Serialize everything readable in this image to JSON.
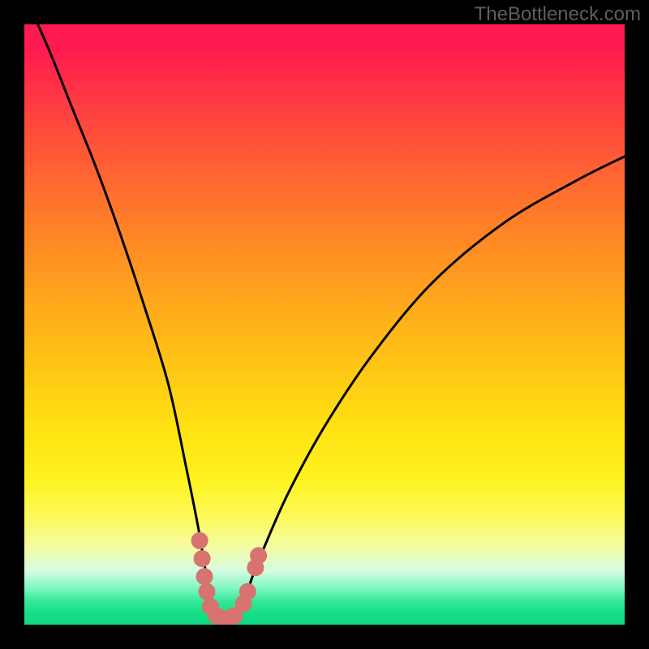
{
  "watermark": "TheBottleneck.com",
  "colors": {
    "frame": "#000000",
    "curve": "#000000",
    "marker_fill": "#d7746f",
    "marker_stroke": "#d7746f",
    "gradient_top": "#ff1a4f",
    "gradient_bottom": "#0fd982"
  },
  "chart_data": {
    "type": "line",
    "title": "",
    "xlabel": "",
    "ylabel": "",
    "xlim": [
      0,
      100
    ],
    "ylim": [
      0,
      100
    ],
    "grid": false,
    "legend": false,
    "note": "Axis values are inferred normalized percentages (0–100). y≈0 is best (green band), y≈100 is worst (red band). Curve is a qualitative bottleneck V-shape with minimum around x≈33.",
    "series": [
      {
        "name": "bottleneck_curve",
        "x": [
          0,
          4,
          8,
          12,
          16,
          20,
          24,
          27,
          29,
          30,
          31,
          32,
          33,
          34,
          35,
          36,
          37,
          38,
          40,
          44,
          50,
          58,
          68,
          80,
          92,
          100
        ],
        "y": [
          105,
          96,
          86,
          76,
          65,
          53,
          40,
          26,
          16,
          10,
          5,
          2,
          1,
          1,
          2,
          3,
          5,
          8,
          13,
          22,
          33,
          45,
          57,
          67,
          74,
          78
        ]
      }
    ],
    "markers": {
      "name": "highlight_points_near_minimum",
      "points": [
        {
          "x": 29.2,
          "y": 14.0
        },
        {
          "x": 29.6,
          "y": 11.0
        },
        {
          "x": 30.0,
          "y": 8.0
        },
        {
          "x": 30.4,
          "y": 5.5
        },
        {
          "x": 31.0,
          "y": 3.0
        },
        {
          "x": 32.0,
          "y": 1.5
        },
        {
          "x": 33.0,
          "y": 1.0
        },
        {
          "x": 34.0,
          "y": 1.0
        },
        {
          "x": 35.0,
          "y": 1.5
        },
        {
          "x": 36.5,
          "y": 3.5
        },
        {
          "x": 37.2,
          "y": 5.5
        },
        {
          "x": 38.5,
          "y": 9.5
        },
        {
          "x": 39.0,
          "y": 11.5
        }
      ]
    }
  }
}
